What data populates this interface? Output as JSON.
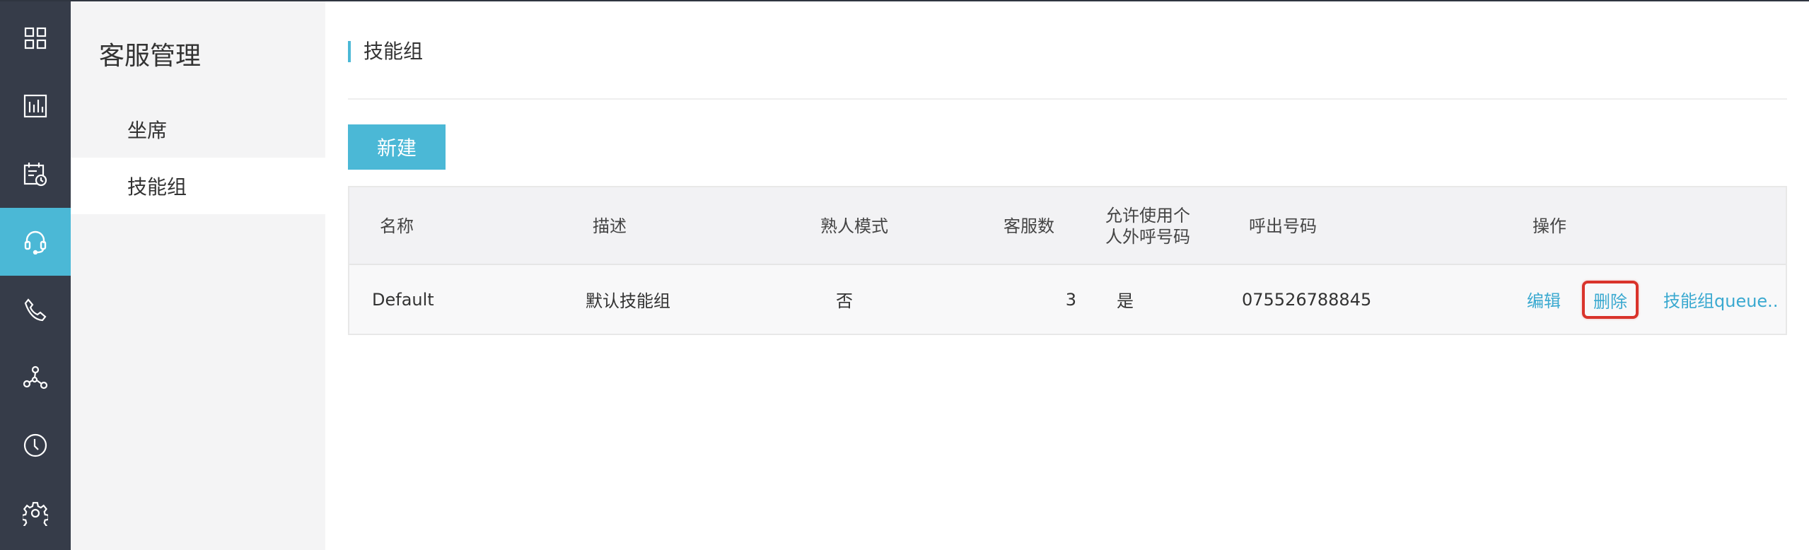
{
  "rail": {
    "items": [
      {
        "icon": "grid-icon"
      },
      {
        "icon": "bar-chart-icon"
      },
      {
        "icon": "calendar-clock-icon"
      },
      {
        "icon": "headset-icon",
        "active": true
      },
      {
        "icon": "phone-icon"
      },
      {
        "icon": "network-icon"
      },
      {
        "icon": "clock-icon"
      },
      {
        "icon": "gear-icon"
      }
    ],
    "active_color": "#4bb8d6",
    "background": "#363c49"
  },
  "submenu": {
    "title": "客服管理",
    "items": [
      {
        "label": "坐席"
      },
      {
        "label": "技能组",
        "selected": true
      }
    ]
  },
  "main": {
    "page_title": "技能组",
    "new_button_label": "新建",
    "table": {
      "columns": [
        "名称",
        "描述",
        "熟人模式",
        "客服数",
        "允许使用个",
        "人外呼号码",
        "呼出号码",
        "操作"
      ],
      "rows": [
        {
          "name": "Default",
          "description": "默认技能组",
          "familiar_mode": "否",
          "agent_count": "3",
          "allow_personal_outbound": "是",
          "outbound_number": "075526788845",
          "actions": {
            "edit": "编辑",
            "delete": "删除",
            "queue": "技能组queue..."
          }
        }
      ]
    }
  }
}
